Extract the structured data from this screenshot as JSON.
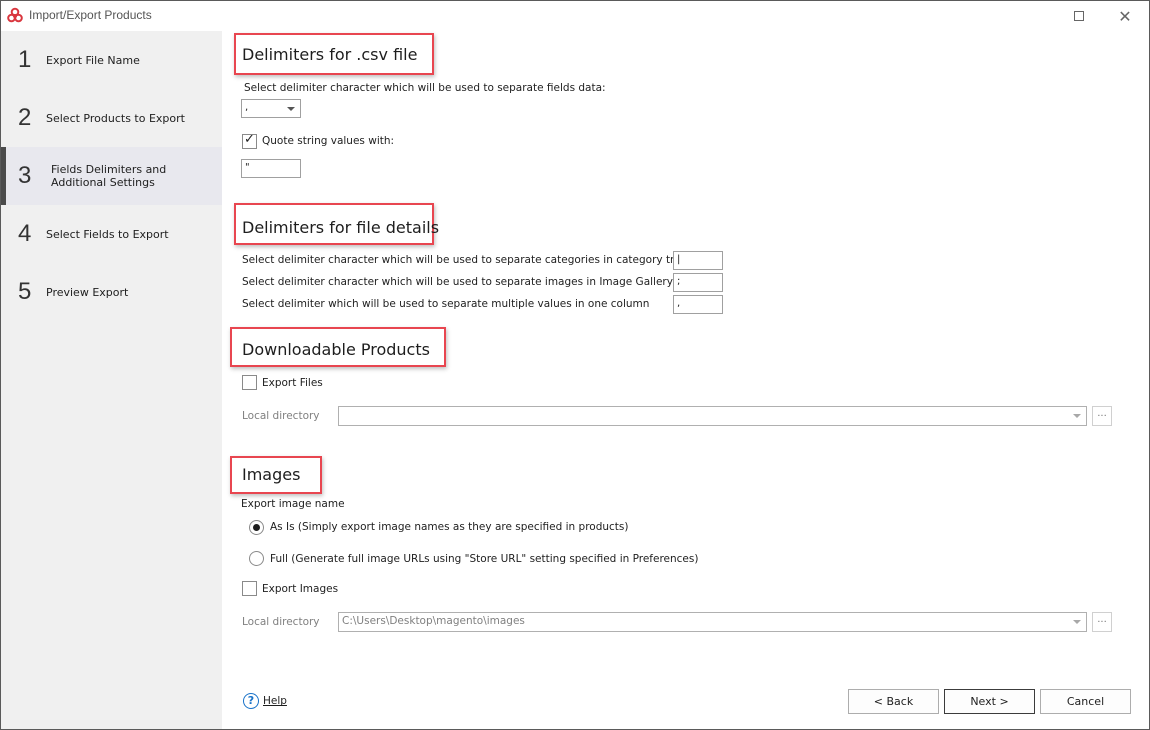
{
  "window": {
    "title": "Import/Export Products",
    "maximize_icon": "maximize-icon",
    "close_icon": "close-icon"
  },
  "sidebar": {
    "active_step": 3,
    "steps": [
      {
        "number": "1",
        "label": "Export File Name"
      },
      {
        "number": "2",
        "label": "Select Products to Export"
      },
      {
        "number": "3",
        "label": "Fields Delimiters and Additional Settings"
      },
      {
        "number": "4",
        "label": "Select Fields to Export"
      },
      {
        "number": "5",
        "label": "Preview Export"
      }
    ]
  },
  "csv": {
    "title": "Delimiters for .csv file",
    "delimiter_label": "Select delimiter character which will be used to separate fields data:",
    "delimiter_value": ",",
    "quote_label": "Quote string values with:",
    "quote_checked": true,
    "quote_value": "\""
  },
  "details": {
    "title": "Delimiters for file details",
    "rows": [
      {
        "label": "Select delimiter character which will be used to separate categories in category tree",
        "value": "|"
      },
      {
        "label": "Select delimiter character which will be used to separate images in Image Gallery",
        "value": ";"
      },
      {
        "label": "Select delimiter which will be used to separate multiple values in one column",
        "value": ","
      }
    ]
  },
  "downloadable": {
    "title": "Downloadable Products",
    "export_files_label": "Export Files",
    "export_files_checked": false,
    "local_dir_label": "Local directory",
    "local_dir_value": "",
    "browse_label": "..."
  },
  "images": {
    "title": "Images",
    "export_name_label": "Export image name",
    "options": [
      {
        "label": "As Is (Simply export image names as they are specified in products)",
        "selected": true
      },
      {
        "label": "Full (Generate full image URLs using \"Store URL\" setting specified in Preferences)",
        "selected": false
      }
    ],
    "export_images_label": "Export Images",
    "export_images_checked": false,
    "local_dir_label": "Local directory",
    "local_dir_value": "C:\\Users\\Desktop\\magento\\images",
    "browse_label": "..."
  },
  "footer": {
    "help_label": "Help",
    "help_mnemonic": "H",
    "back_label": "< Back",
    "next_label": "Next >",
    "cancel_label": "Cancel"
  },
  "colors": {
    "highlight": "#e84650",
    "accent": "#1a73c9",
    "sidebar_bg": "#f0f0f0",
    "active_step_bg": "#e8e8ee"
  }
}
